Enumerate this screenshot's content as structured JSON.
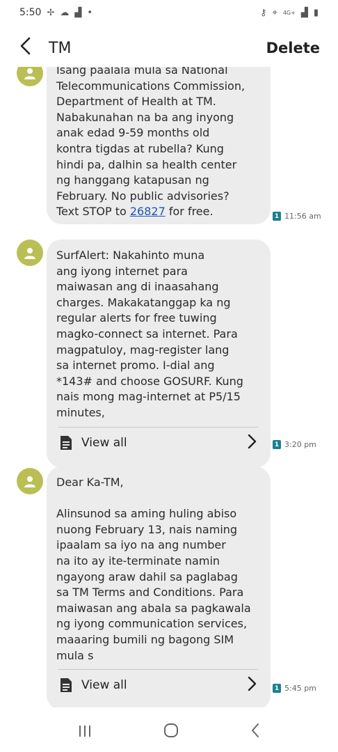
{
  "status_bar": {
    "time": "5:50",
    "signal_label": "4G+"
  },
  "header": {
    "contact": "TM",
    "delete_label": "Delete"
  },
  "messages": [
    {
      "text_before_link": "Isang paalala mula sa National\nTelecommunications Commission,\nDepartment of Health at TM.\nNabakunahan na ba ang inyong\nanak edad 9-59 months old\nkontra tigdas at rubella? Kung\nhindi pa, dalhin sa health center\nng hanggang katapusan ng\nFebruary. No public advisories?\nText STOP to ",
      "link": "26827",
      "text_after_link": " for free.",
      "sim": "1",
      "time": "11:56 am"
    },
    {
      "text": "SurfAlert: Nakahinto muna\nang iyong internet para\nmaiwasan ang di inaasahang\ncharges. Makakatanggap ka ng\nregular alerts for free tuwing\nmagko-connect sa internet. Para\nmagpatuloy, mag-register lang\nsa internet promo. I-dial ang\n*143# and choose GOSURF. Kung\nnais mong mag-internet at P5/15\nminutes,",
      "view_all": "View all",
      "sim": "1",
      "time": "3:20 pm"
    },
    {
      "text": "Dear Ka-TM,\n\nAlinsunod sa aming huling abiso\nnuong February 13, nais naming\nipaalam sa iyo na ang number\nna ito ay ite-terminate namin\nngayong araw dahil sa paglabag\nsa TM Terms and Conditions. Para\nmaiwasan ang abala sa pagkawala\nng iyong communication services,\nmaaaring bumili ng bagong SIM\nmula s",
      "view_all": "View all",
      "sim": "1",
      "time": "5:45 pm"
    }
  ],
  "colors": {
    "avatar": "#b9bf55",
    "bubble": "#ececec",
    "link": "#1d54b5",
    "sim_badge": "#1b7f8f"
  }
}
